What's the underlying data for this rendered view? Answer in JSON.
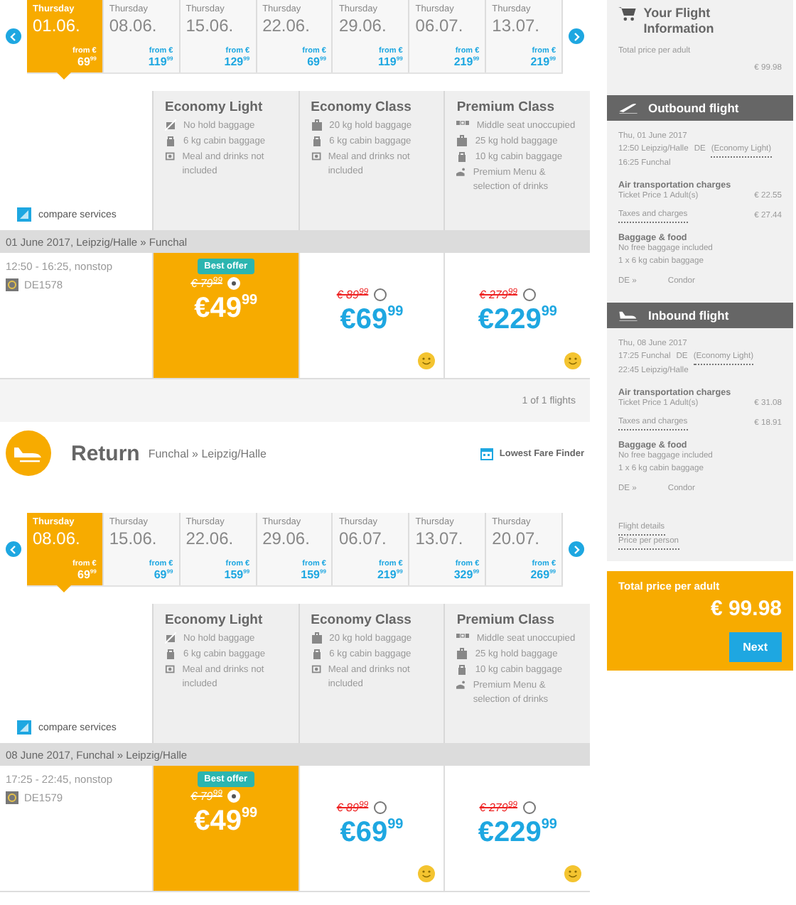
{
  "flights": [
    {
      "dates": [
        {
          "day": "Thursday",
          "date": "01.06.",
          "from": "from €",
          "price": "69$^{99}$",
          "selected": true
        },
        {
          "day": "Thursday",
          "date": "08.06.",
          "from": "from €",
          "price": "119$^{99}$",
          "selected": false
        },
        {
          "day": "Thursday",
          "date": "15.06.",
          "from": "from €",
          "price": "129$^{99}$",
          "selected": false
        },
        {
          "day": "Thursday",
          "date": "22.06.",
          "from": "from €",
          "price": "69$^{99}$",
          "selected": false
        },
        {
          "day": "Thursday",
          "date": "29.06.",
          "from": "from €",
          "price": "119$^{99}$",
          "selected": false
        },
        {
          "day": "Thursday",
          "date": "06.07.",
          "from": "from €",
          "price": "219$^{99}$",
          "selected": false
        },
        {
          "day": "Thursday",
          "date": "13.07.",
          "from": "from €",
          "price": "219$^{99}$",
          "selected": false
        }
      ],
      "compare": "compare services",
      "fares": [
        {
          "name": "Economy Light",
          "features": [
            {
              "kind": "no-hold-bag",
              "text": "No hold baggage"
            },
            {
              "kind": "cabin-bag",
              "text": "6 kg cabin baggage"
            },
            {
              "kind": "meal",
              "text": "Meal and drinks not included"
            }
          ]
        },
        {
          "name": "Economy Class",
          "features": [
            {
              "kind": "hold-bag",
              "text": "20 kg hold baggage"
            },
            {
              "kind": "cabin-bag",
              "text": "6 kg cabin baggage"
            },
            {
              "kind": "meal",
              "text": "Meal and drinks not included"
            }
          ]
        },
        {
          "name": "Premium Class",
          "features": [
            {
              "kind": "seat",
              "text": "Middle seat unoccupied"
            },
            {
              "kind": "hold-bag",
              "text": "25 kg hold baggage"
            },
            {
              "kind": "cabin-bag",
              "text": "10 kg cabin baggage"
            },
            {
              "kind": "premium-menu",
              "text": "Premium Menu & selection of drinks"
            }
          ]
        }
      ],
      "route": "01 June 2017, Leipzig/Halle » Funchal",
      "time": "12:50 - 16:25, nonstop",
      "number": "DE1578",
      "offers": [
        {
          "badge": "Best offer",
          "old": "€ 79$^{99}$",
          "price": "€49$^{99}$",
          "selected": true,
          "smiley": false
        },
        {
          "old": "€ 89$^{99}$",
          "price": "€69$^{99}$",
          "selected": false,
          "smiley": true
        },
        {
          "old": "€ 279$^{99}$",
          "price": "€229$^{99}$",
          "selected": false,
          "smiley": true
        }
      ],
      "count": "1 of 1 flights"
    },
    {
      "header": {
        "title": "Return",
        "route": "Funchal » Leipzig/Halle",
        "finder": "Lowest Fare Finder"
      },
      "dates": [
        {
          "day": "Thursday",
          "date": "08.06.",
          "from": "from €",
          "price": "69$^{99}$",
          "selected": true
        },
        {
          "day": "Thursday",
          "date": "15.06.",
          "from": "from €",
          "price": "69$^{99}$",
          "selected": false
        },
        {
          "day": "Thursday",
          "date": "22.06.",
          "from": "from €",
          "price": "159$^{99}$",
          "selected": false
        },
        {
          "day": "Thursday",
          "date": "29.06.",
          "from": "from €",
          "price": "159$^{99}$",
          "selected": false
        },
        {
          "day": "Thursday",
          "date": "06.07.",
          "from": "from €",
          "price": "219$^{99}$",
          "selected": false
        },
        {
          "day": "Thursday",
          "date": "13.07.",
          "from": "from €",
          "price": "329$^{99}$",
          "selected": false
        },
        {
          "day": "Thursday",
          "date": "20.07.",
          "from": "from €",
          "price": "269$^{99}$",
          "selected": false
        }
      ],
      "compare": "compare services",
      "fares": [
        {
          "name": "Economy Light",
          "features": [
            {
              "kind": "no-hold-bag",
              "text": "No hold baggage"
            },
            {
              "kind": "cabin-bag",
              "text": "6 kg cabin baggage"
            },
            {
              "kind": "meal",
              "text": "Meal and drinks not included"
            }
          ]
        },
        {
          "name": "Economy Class",
          "features": [
            {
              "kind": "hold-bag",
              "text": "20 kg hold baggage"
            },
            {
              "kind": "cabin-bag",
              "text": "6 kg cabin baggage"
            },
            {
              "kind": "meal",
              "text": "Meal and drinks not included"
            }
          ]
        },
        {
          "name": "Premium Class",
          "features": [
            {
              "kind": "seat",
              "text": "Middle seat unoccupied"
            },
            {
              "kind": "hold-bag",
              "text": "25 kg hold baggage"
            },
            {
              "kind": "cabin-bag",
              "text": "10 kg cabin baggage"
            },
            {
              "kind": "premium-menu",
              "text": "Premium Menu & selection of drinks"
            }
          ]
        }
      ],
      "route": "08 June 2017, Funchal » Leipzig/Halle",
      "time": "17:25 - 22:45, nonstop",
      "number": "DE1579",
      "offers": [
        {
          "badge": "Best offer",
          "old": "€ 79$^{99}$",
          "price": "€49$^{99}$",
          "selected": true,
          "smiley": false
        },
        {
          "old": "€ 89$^{99}$",
          "price": "€69$^{99}$",
          "selected": false,
          "smiley": true
        },
        {
          "old": "€ 279$^{99}$",
          "price": "€229$^{99}$",
          "selected": false,
          "smiley": true
        }
      ]
    }
  ],
  "summary": {
    "title": "Your Flight Information",
    "total_label": "Total price per adult",
    "total": "€ 99.98",
    "legs": [
      {
        "title": "Outbound flight",
        "kind": "outbound",
        "date": "Thu, 01 June 2017",
        "dep": "12:50 Leipzig/Halle",
        "carrier": "DE",
        "fare": "(Economy Light)",
        "arr": "16:25 Funchal",
        "charges_title": "Air transportation charges",
        "ticket_label": "Ticket Price 1 Adult(s)",
        "ticket": "€ 22.55",
        "taxes_label": "Taxes and charges",
        "taxes": "€ 27.44",
        "baggage_title": "Baggage & food",
        "baggage": [
          "No free baggage included",
          "1 x 6 kg cabin baggage"
        ],
        "airline_code": "DE »",
        "airline": "Condor"
      },
      {
        "title": "Inbound flight",
        "kind": "inbound",
        "date": "Thu, 08 June 2017",
        "dep": "17:25 Funchal",
        "carrier": "DE",
        "fare": "(Economy Light)",
        "arr": "22:45 Leipzig/Halle",
        "charges_title": "Air transportation charges",
        "ticket_label": "Ticket Price 1 Adult(s)",
        "ticket": "€ 31.08",
        "taxes_label": "Taxes and charges",
        "taxes": "€ 18.91",
        "baggage_title": "Baggage & food",
        "baggage": [
          "No free baggage included",
          "1 x 6 kg cabin baggage"
        ],
        "airline_code": "DE »",
        "airline": "Condor"
      }
    ],
    "links": [
      "Flight details",
      "Price per person"
    ],
    "box": {
      "label": "Total price per adult",
      "total": "€ 99.98",
      "button": "Next"
    }
  }
}
